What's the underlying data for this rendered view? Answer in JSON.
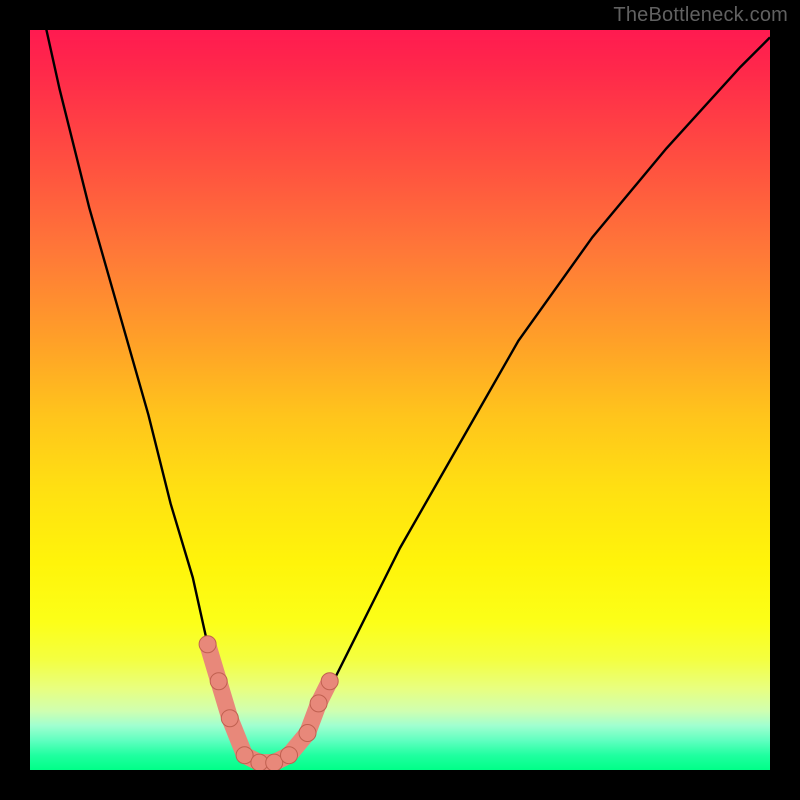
{
  "watermark": "TheBottleneck.com",
  "chart_data": {
    "type": "line",
    "title": "",
    "xlabel": "",
    "ylabel": "",
    "x_range": [
      0,
      100
    ],
    "y_range": [
      0,
      100
    ],
    "series": [
      {
        "name": "bottleneck-curve",
        "x": [
          0,
          4,
          8,
          12,
          16,
          19,
          22,
          24,
          26,
          27.5,
          29,
          31,
          33,
          35,
          38,
          40,
          44,
          50,
          58,
          66,
          76,
          86,
          96,
          100
        ],
        "y": [
          110,
          92,
          76,
          62,
          48,
          36,
          26,
          17,
          10,
          5,
          2,
          1,
          1,
          2,
          6,
          10,
          18,
          30,
          44,
          58,
          72,
          84,
          95,
          99
        ]
      }
    ],
    "markers": {
      "name": "highlight-points",
      "points": [
        {
          "x": 24.0,
          "y": 17
        },
        {
          "x": 25.5,
          "y": 12
        },
        {
          "x": 27.0,
          "y": 7
        },
        {
          "x": 29.0,
          "y": 2
        },
        {
          "x": 31.0,
          "y": 1
        },
        {
          "x": 33.0,
          "y": 1
        },
        {
          "x": 35.0,
          "y": 2
        },
        {
          "x": 37.5,
          "y": 5
        },
        {
          "x": 39.0,
          "y": 9
        },
        {
          "x": 40.5,
          "y": 12
        }
      ]
    },
    "background": {
      "type": "vertical-gradient",
      "stops": [
        {
          "pos": 0,
          "color": "#ff1a50"
        },
        {
          "pos": 50,
          "color": "#ffc41c"
        },
        {
          "pos": 80,
          "color": "#fcff18"
        },
        {
          "pos": 100,
          "color": "#00ff88"
        }
      ]
    }
  }
}
